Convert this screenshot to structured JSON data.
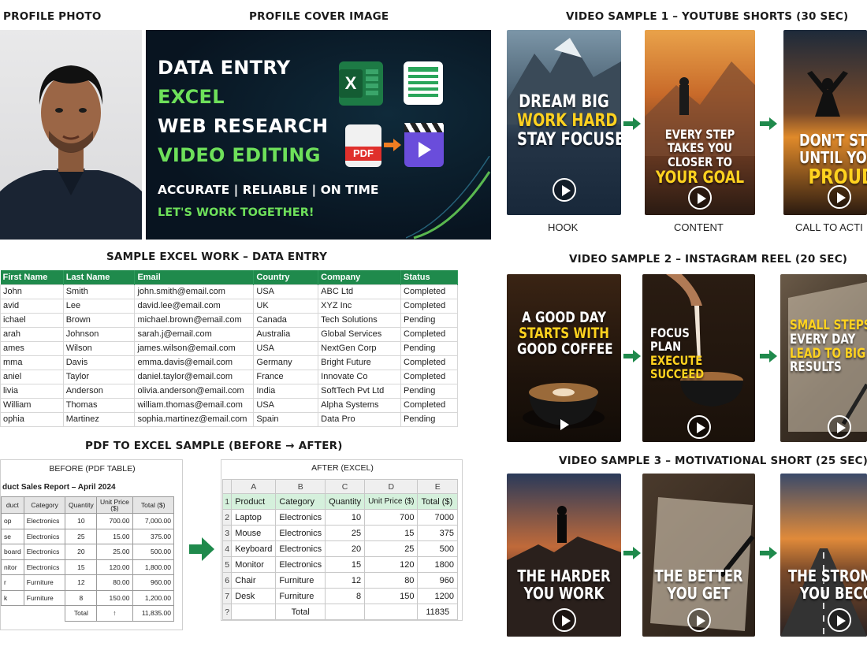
{
  "headings": {
    "profile_photo": "PROFILE PHOTO",
    "profile_cover": "PROFILE COVER IMAGE",
    "video1": "VIDEO SAMPLE 1 – YOUTUBE SHORTS (30 SEC)",
    "video2": "VIDEO SAMPLE 2 – INSTAGRAM REEL (20 SEC)",
    "video3": "VIDEO SAMPLE 3 – MOTIVATIONAL SHORT (25 SEC)",
    "excel": "SAMPLE EXCEL WORK – DATA ENTRY",
    "pdf_to_excel": "PDF TO EXCEL SAMPLE (BEFORE → AFTER)"
  },
  "cover": {
    "line1": "DATA ENTRY",
    "line2": "EXCEL",
    "line3": "WEB RESEARCH",
    "line4": "VIDEO EDITING",
    "tagline": "ACCURATE | RELIABLE | ON TIME",
    "cta": "LET'S WORK TOGETHER!",
    "icons": [
      "excel-icon",
      "spreadsheet-icon",
      "pdf-icon",
      "video-editor-icon"
    ],
    "pdf_label": "PDF",
    "excel_letter": "X"
  },
  "video1": {
    "cards": [
      {
        "lines": [
          "DREAM BIG",
          "WORK HARD",
          "STAY FOCUSED"
        ]
      },
      {
        "lines": [
          "EVERY STEP",
          "TAKES YOU",
          "CLOSER TO",
          "YOUR GOAL"
        ]
      },
      {
        "lines": [
          "DON'T STO",
          "UNTIL YOU'R",
          "PROUD"
        ]
      }
    ],
    "labels": [
      "HOOK",
      "CONTENT",
      "CALL TO ACTI"
    ]
  },
  "video2": {
    "cards": [
      {
        "lines": [
          "A GOOD DAY",
          "STARTS WITH",
          "GOOD COFFEE"
        ]
      },
      {
        "lines": [
          "FOCUS",
          "PLAN",
          "EXECUTE",
          "SUCCEED"
        ]
      },
      {
        "lines": [
          "SMALL STEPS",
          "EVERY DAY",
          "LEAD TO BIG",
          "RESULTS"
        ]
      }
    ]
  },
  "video3": {
    "cards": [
      {
        "lines": [
          "THE HARDER",
          "YOU WORK"
        ]
      },
      {
        "lines": [
          "THE BETTER",
          "YOU GET"
        ]
      },
      {
        "lines": [
          "THE STRONG",
          "YOU BECOM"
        ]
      }
    ]
  },
  "excel": {
    "columns": [
      "First Name",
      "Last Name",
      "Email",
      "Country",
      "Company",
      "Status"
    ],
    "rows": [
      [
        "John",
        "Smith",
        "john.smith@email.com",
        "USA",
        "ABC Ltd",
        "Completed"
      ],
      [
        "avid",
        "Lee",
        "david.lee@email.com",
        "UK",
        "XYZ Inc",
        "Completed"
      ],
      [
        "ichael",
        "Brown",
        "michael.brown@email.com",
        "Canada",
        "Tech Solutions",
        "Pending"
      ],
      [
        "arah",
        "Johnson",
        "sarah.j@email.com",
        "Australia",
        "Global Services",
        "Completed"
      ],
      [
        "ames",
        "Wilson",
        "james.wilson@email.com",
        "USA",
        "NextGen Corp",
        "Pending"
      ],
      [
        "mma",
        "Davis",
        "emma.davis@email.com",
        "Germany",
        "Bright Future",
        "Completed"
      ],
      [
        "aniel",
        "Taylor",
        "daniel.taylor@email.com",
        "France",
        "Innovate Co",
        "Completed"
      ],
      [
        "livia",
        "Anderson",
        "olivia.anderson@email.com",
        "India",
        "SoftTech Pvt Ltd",
        "Pending"
      ],
      [
        "William",
        "Thomas",
        "william.thomas@email.com",
        "USA",
        "Alpha Systems",
        "Completed"
      ],
      [
        "ophia",
        "Martinez",
        "sophia.martinez@email.com",
        "Spain",
        "Data Pro",
        "Pending"
      ]
    ]
  },
  "pdf_before": {
    "label": "BEFORE (PDF TABLE)",
    "title": "duct Sales Report – April 2024",
    "columns": [
      "duct",
      "Category",
      "Quantity",
      "Unit Price ($)",
      "Total ($)"
    ],
    "rows": [
      [
        "op",
        "Electronics",
        "10",
        "700.00",
        "7,000.00"
      ],
      [
        "se",
        "Electronics",
        "25",
        "15.00",
        "375.00"
      ],
      [
        "board",
        "Electronics",
        "20",
        "25.00",
        "500.00"
      ],
      [
        "nitor",
        "Electronics",
        "15",
        "120.00",
        "1,800.00"
      ],
      [
        "r",
        "Furniture",
        "12",
        "80.00",
        "960.00"
      ],
      [
        "k",
        "Furniture",
        "8",
        "150.00",
        "1,200.00"
      ]
    ],
    "total_label": "Total",
    "total_mark": "↑",
    "total_value": "11,835.00"
  },
  "after_excel": {
    "label": "AFTER (EXCEL)",
    "col_letters": [
      "A",
      "B",
      "C",
      "D",
      "E"
    ],
    "header_row_num": "1",
    "columns": [
      "Product",
      "Category",
      "Quantity",
      "Unit Price ($)",
      "Total ($)"
    ],
    "rows": [
      {
        "num": "2",
        "cells": [
          "Laptop",
          "Electronics",
          "10",
          "700",
          "7000"
        ]
      },
      {
        "num": "3",
        "cells": [
          "Mouse",
          "Electronics",
          "25",
          "15",
          "375"
        ]
      },
      {
        "num": "4",
        "cells": [
          "Keyboard",
          "Electronics",
          "20",
          "25",
          "500"
        ]
      },
      {
        "num": "5",
        "cells": [
          "Monitor",
          "Electronics",
          "15",
          "120",
          "1800"
        ]
      },
      {
        "num": "6",
        "cells": [
          "Chair",
          "Furniture",
          "12",
          "80",
          "960"
        ]
      },
      {
        "num": "7",
        "cells": [
          "Desk",
          "Furniture",
          "8",
          "150",
          "1200"
        ]
      }
    ],
    "total_row_num": "?",
    "total_label": "Total",
    "total_value": "11835"
  },
  "colors": {
    "excel_green": "#1f8a4c",
    "accent_green": "#6ee05a",
    "overlay_yellow": "#ffd21f",
    "arrow_green": "#1f8a4c"
  }
}
